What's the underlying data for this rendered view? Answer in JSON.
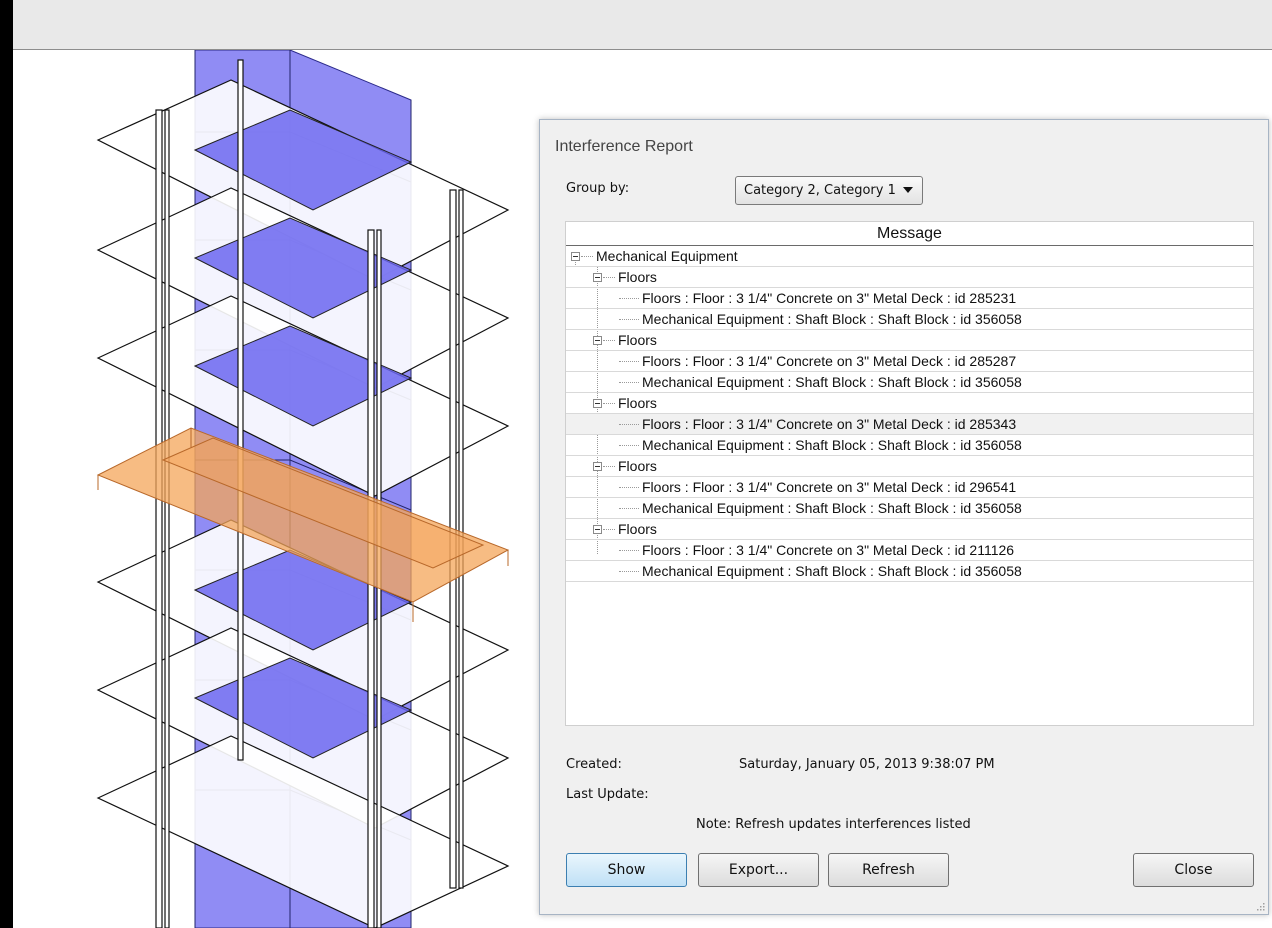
{
  "dialog": {
    "title": "Interference Report",
    "group_by_label": "Group by:",
    "group_by_value": "Category 2, Category 1",
    "column_header": "Message",
    "tree": {
      "root": "Mechanical Equipment",
      "groups": [
        {
          "label": "Floors",
          "items": [
            "Floors : Floor : 3 1/4\" Concrete on 3\" Metal Deck : id 285231",
            "Mechanical Equipment : Shaft Block : Shaft Block : id 356058"
          ]
        },
        {
          "label": "Floors",
          "items": [
            "Floors : Floor : 3 1/4\" Concrete on 3\" Metal Deck : id 285287",
            "Mechanical Equipment : Shaft Block : Shaft Block : id 356058"
          ]
        },
        {
          "label": "Floors",
          "items": [
            "Floors : Floor : 3 1/4\" Concrete on 3\" Metal Deck : id 285343",
            "Mechanical Equipment : Shaft Block : Shaft Block : id 356058"
          ]
        },
        {
          "label": "Floors",
          "items": [
            "Floors : Floor : 3 1/4\" Concrete on 3\" Metal Deck : id 296541",
            "Mechanical Equipment : Shaft Block : Shaft Block : id 356058"
          ]
        },
        {
          "label": "Floors",
          "items": [
            "Floors : Floor : 3 1/4\" Concrete on 3\" Metal Deck : id 211126",
            "Mechanical Equipment : Shaft Block : Shaft Block : id 356058"
          ]
        }
      ]
    },
    "created_label": "Created:",
    "created_value": "Saturday, January 05, 2013 9:38:07 PM",
    "last_update_label": "Last Update:",
    "note": "Note: Refresh updates interferences listed",
    "buttons": {
      "show": "Show",
      "export": "Export...",
      "refresh": "Refresh",
      "close": "Close"
    }
  },
  "colors": {
    "shaft_block": "#6b66f0",
    "highlight_floor": "#f4a55a",
    "primary_button": "#bfe0f6"
  }
}
